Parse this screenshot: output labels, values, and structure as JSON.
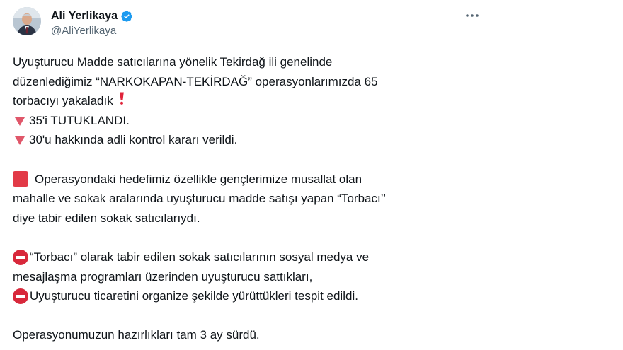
{
  "author": {
    "display_name": "Ali Yerlikaya",
    "handle": "@AliYerlikaya",
    "verified": true,
    "verified_color": "#1d9bf0"
  },
  "menu": {
    "more_icon": "more-horizontal-icon"
  },
  "tweet": {
    "lines": {
      "l1": "Uyuşturucu Madde satıcılarına yönelik Tekirdağ ili genelinde",
      "l2": "düzenlediğimiz “NARKOKAPAN-TEKİRDAĞ” operasyonlarımızda 65",
      "l3": "torbacıyı yakaladık",
      "l4": "35'i TUTUKLANDI.",
      "l5": "30'u hakkında adli kontrol kararı verildi.",
      "l6": "Operasyondaki hedefimiz özellikle gençlerimize musallat olan",
      "l7": "mahalle ve sokak aralarında uyuşturucu madde satışı yapan “Torbacı’’",
      "l8": "diye tabir edilen sokak satıcılarıydı.",
      "l9": "“Torbacı” olarak tabir edilen sokak satıcılarının sosyal medya ve",
      "l10": "mesajlaşma programları üzerinden uyuşturucu sattıkları,",
      "l11": "Uyuşturucu ticaretini organize şekilde yürüttükleri tespit edildi.",
      "l12": "Operasyonumuzun hazırlıkları tam 3 ay sürdü."
    },
    "emoji_icons": [
      "red-exclamation-icon",
      "red-triangle-down-icon",
      "red-square-icon",
      "no-entry-icon"
    ]
  },
  "colors": {
    "text": "#0f1419",
    "secondary_text": "#536471",
    "emoji_red": "#e23a47"
  }
}
